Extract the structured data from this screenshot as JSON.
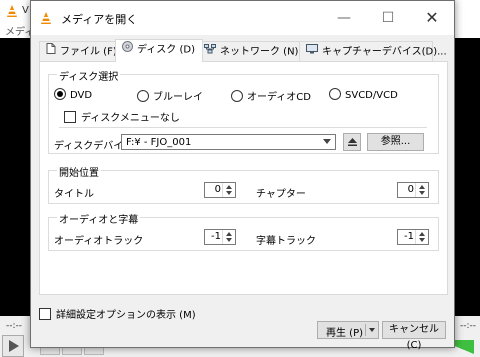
{
  "background": {
    "window_title_fragment": "V",
    "menu_fragment": "メディア",
    "time_left": "--:--",
    "time_right": "--:--"
  },
  "dialog": {
    "title": "メディアを開く",
    "window_buttons": {
      "minimize": "—",
      "maximize": "☐",
      "close": "✕"
    },
    "tabs": [
      {
        "label": "ファイル (F)",
        "icon": "file-icon"
      },
      {
        "label": "ディスク (D)",
        "icon": "disc-icon",
        "active": true
      },
      {
        "label": "ネットワーク (N)",
        "icon": "network-icon"
      },
      {
        "label": "キャプチャーデバイス(D)...",
        "icon": "capture-device-icon"
      }
    ],
    "disc_selection": {
      "title": "ディスク選択",
      "options": [
        {
          "label": "DVD",
          "selected": true
        },
        {
          "label": "ブルーレイ",
          "selected": false
        },
        {
          "label": "オーディオCD",
          "selected": false
        },
        {
          "label": "SVCD/VCD",
          "selected": false
        }
      ],
      "no_disc_menus_label": "ディスクメニューなし",
      "no_disc_menus_checked": false,
      "device_label": "ディスクデバイス",
      "device_value": "F:¥ - FJO_001",
      "browse_label": "参照..."
    },
    "start_position": {
      "title": "開始位置",
      "title_label": "タイトル",
      "title_value": "0",
      "chapter_label": "チャプター",
      "chapter_value": "0"
    },
    "audio_subtitles": {
      "title": "オーディオと字幕",
      "audio_track_label": "オーディオトラック",
      "audio_track_value": "-1",
      "subtitle_track_label": "字幕トラック",
      "subtitle_track_value": "-1"
    },
    "show_more_options_label": "詳細設定オプションの表示 (M)",
    "show_more_options_checked": false,
    "play_label": "再生 (P)",
    "cancel_label": "キャンセル (C)"
  }
}
